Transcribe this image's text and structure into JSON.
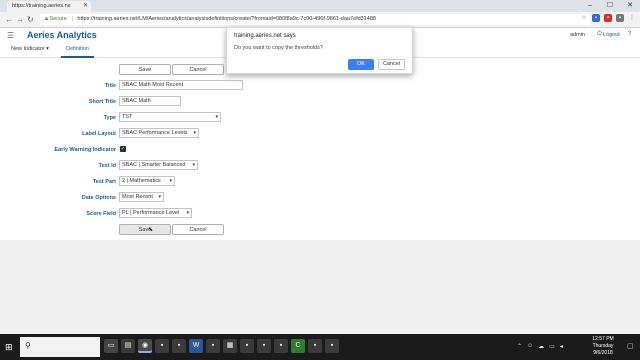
{
  "browser": {
    "tab_title": "https://training.aeries.ne",
    "secure_label": "Secure",
    "url": "https://training.aeries.net/LM/Aeries/analytics/analysisdefinitions/create/?fromaid=080f8a9c-7c00-496f-9861-daa7efd31488"
  },
  "app": {
    "title": "Aeries Analytics",
    "user": "admin",
    "logout_label": "Logout"
  },
  "subnav": {
    "new_indicator_label": "New Indicator",
    "definition_tab": "Definition"
  },
  "form": {
    "save_label": "Save",
    "cancel_label": "Cancel",
    "fields": {
      "title": {
        "label": "Title",
        "value": "SBAC Math Most Recent"
      },
      "short_title": {
        "label": "Short Title",
        "value": "SBAC Math"
      },
      "type": {
        "label": "Type",
        "value": "TST"
      },
      "label_layout": {
        "label": "Label Layout",
        "value": "SBAC Performance Levels"
      },
      "early_warning": {
        "label": "Early Warning Indicator",
        "checked": true
      },
      "test_id": {
        "label": "Test Id",
        "value": "SBAC | Smarter Balanced"
      },
      "test_part": {
        "label": "Test Part",
        "value": "2 | Mathematics"
      },
      "date_options": {
        "label": "Date Options",
        "value": "Most Recent"
      },
      "score_field": {
        "label": "Score Field",
        "value": "PL | Performance Level"
      }
    }
  },
  "dialog": {
    "title": "training.aeries.net says",
    "message": "Do you want to copy the thresholds?",
    "ok_label": "OK",
    "cancel_label": "Cancel"
  },
  "taskbar": {
    "time": "12:57 PM",
    "day": "Thursday",
    "date": "9/6/2018"
  }
}
